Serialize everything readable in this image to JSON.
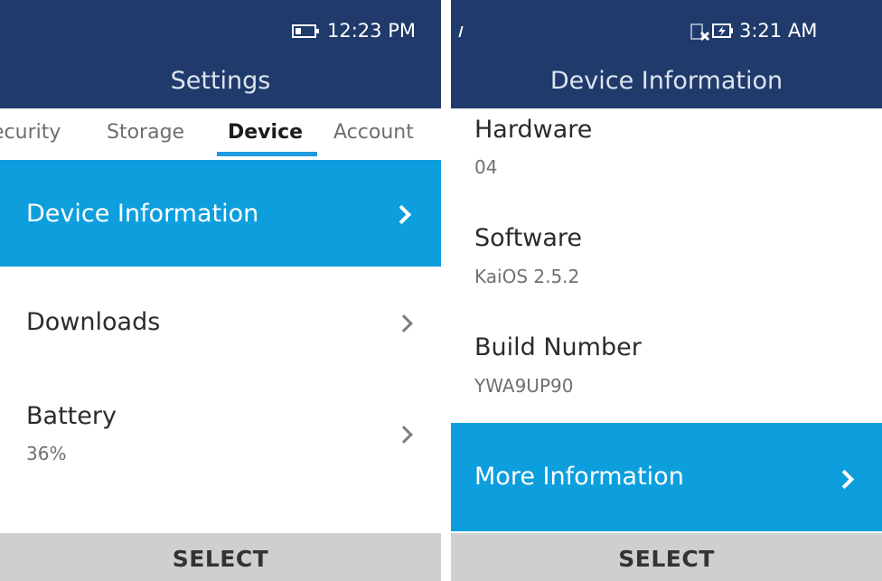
{
  "left_screen": {
    "status": {
      "time": "12:23 PM",
      "icons": [
        "battery-icon"
      ]
    },
    "header": {
      "title": "Settings"
    },
    "tabs": [
      {
        "label": "ecurity"
      },
      {
        "label": "Storage"
      },
      {
        "label": "Device",
        "active": true
      },
      {
        "label": "Account"
      }
    ],
    "items": [
      {
        "label": "Device Information",
        "sub": "",
        "focused": true
      },
      {
        "label": "Downloads",
        "sub": ""
      },
      {
        "label": "Battery",
        "sub": "36%"
      }
    ],
    "softkey": {
      "center": "SELECT"
    }
  },
  "right_screen": {
    "status": {
      "time": "3:21 AM",
      "icons": [
        "signal-icon",
        "no-sim-icon",
        "charging-battery-icon"
      ]
    },
    "header": {
      "title": "Device Information"
    },
    "info": [
      {
        "label": "Hardware",
        "value": "04"
      },
      {
        "label": "Software",
        "value": "KaiOS 2.5.2"
      },
      {
        "label": "Build Number",
        "value": "YWA9UP90"
      }
    ],
    "more": {
      "label": "More Information"
    },
    "softkey": {
      "center": "SELECT"
    }
  },
  "colors": {
    "header": "#203a6b",
    "focus": "#0d9fdd",
    "tab_underline": "#1f9be0",
    "softkey_bg": "#cfcfcf"
  }
}
